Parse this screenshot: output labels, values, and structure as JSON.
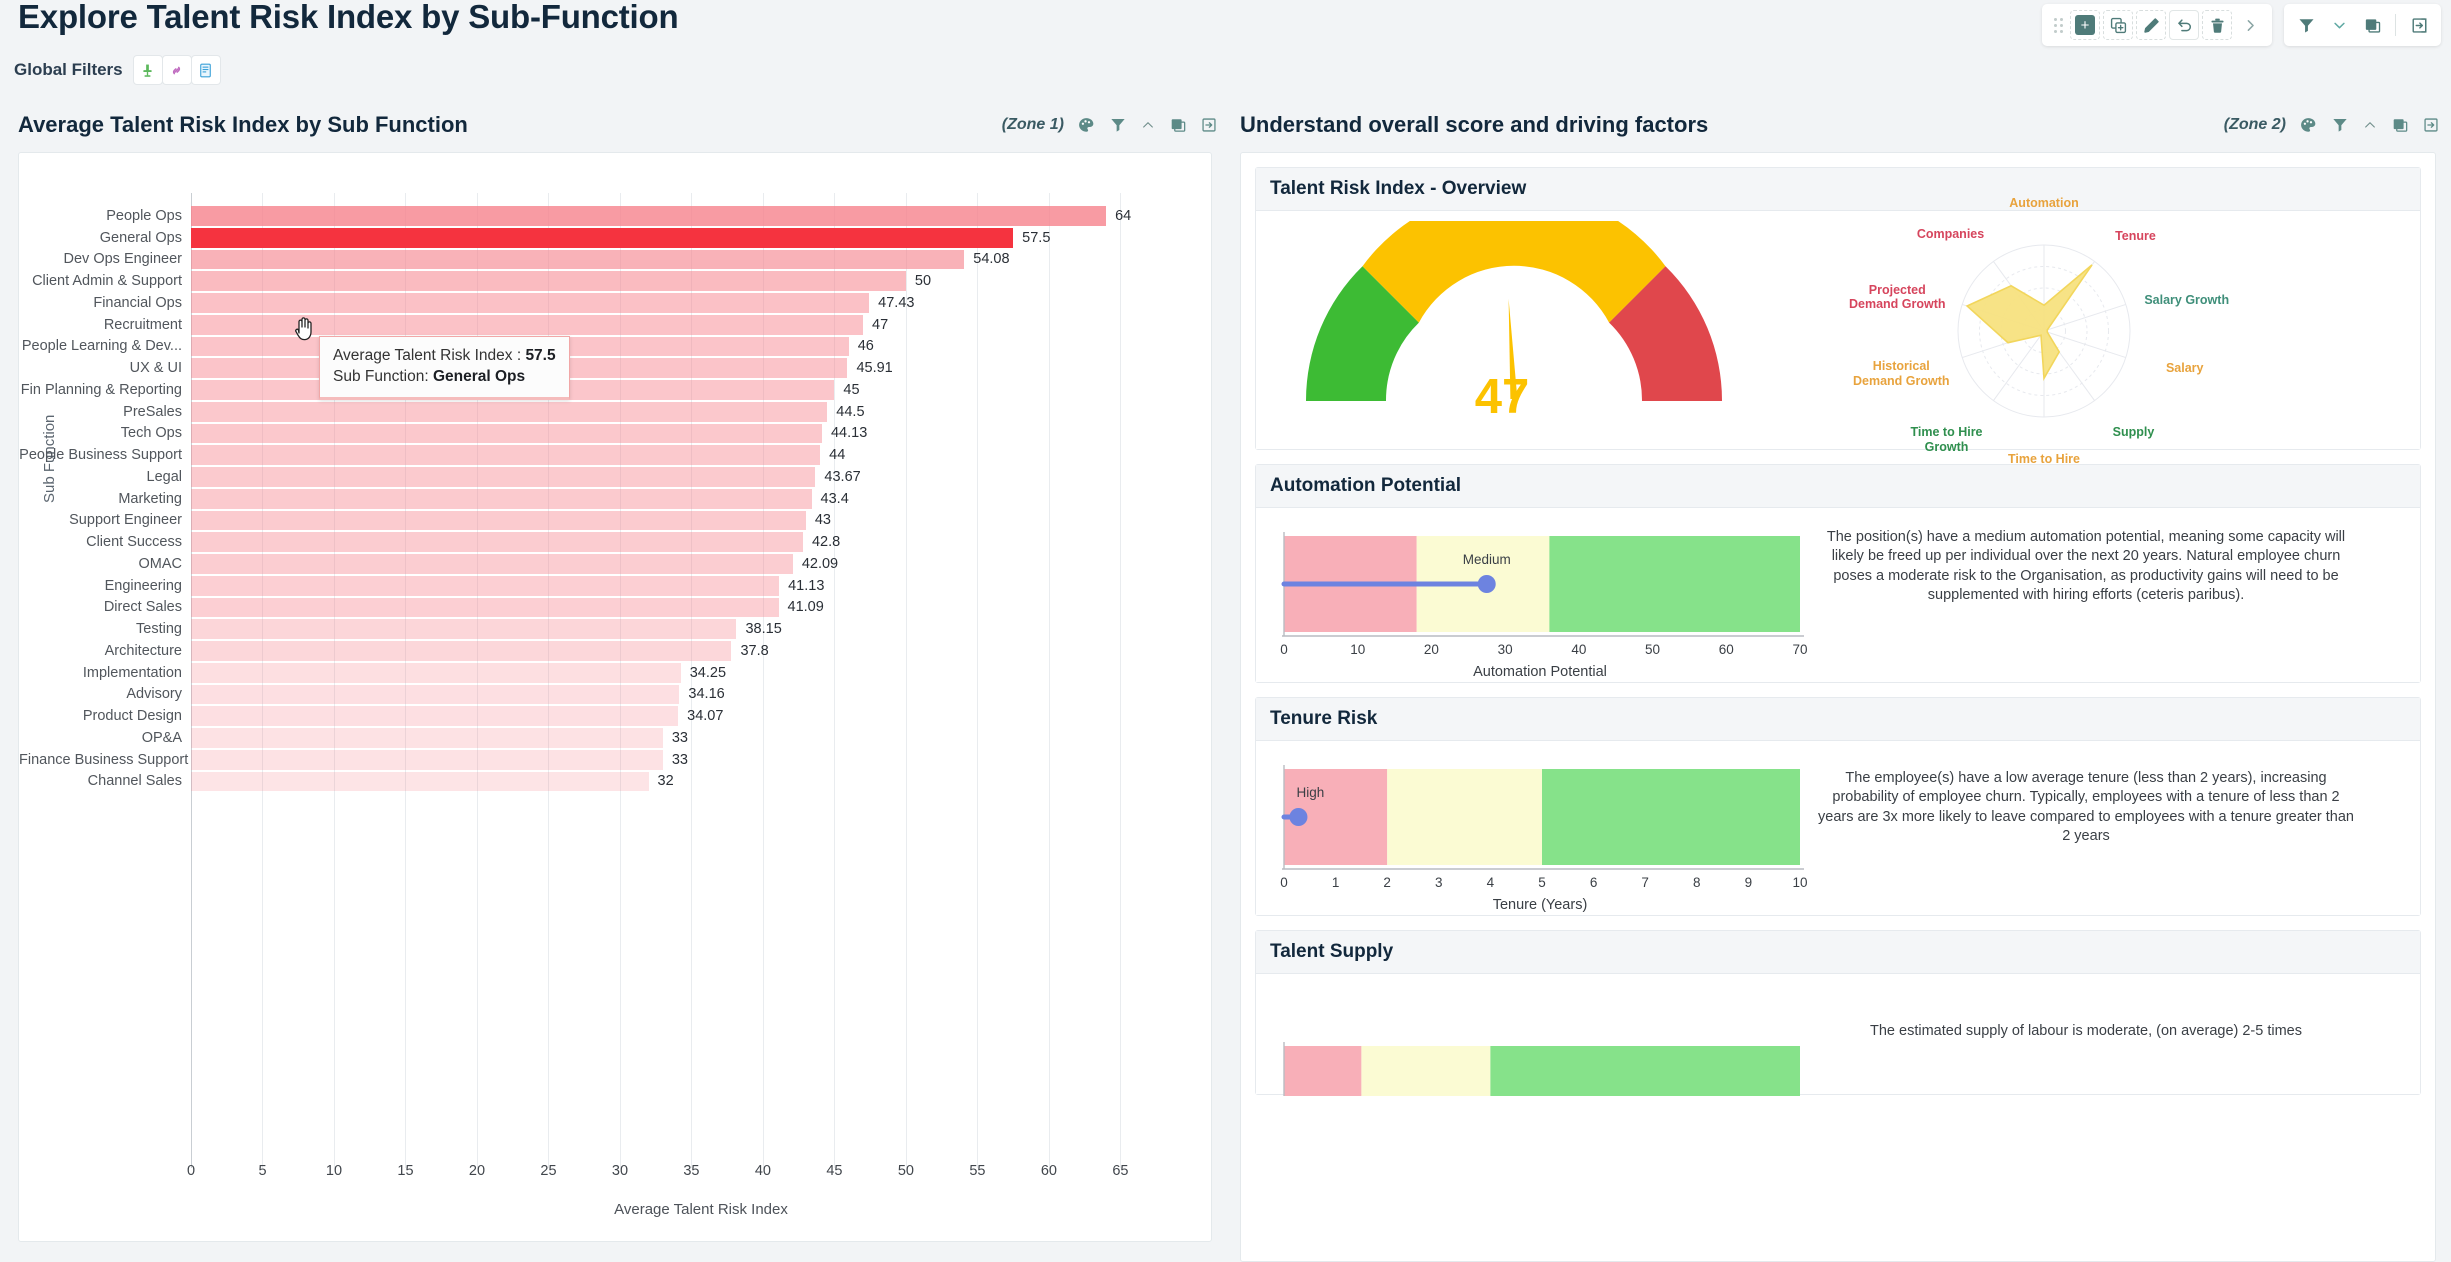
{
  "header": {
    "title": "Explore Talent Risk Index by Sub-Function",
    "global_filters_label": "Global Filters",
    "filter_chips": [
      {
        "icon": "person-filter-icon",
        "glyph": "♟"
      },
      {
        "icon": "link-filter-icon",
        "glyph": "🔗"
      },
      {
        "icon": "document-filter-icon",
        "glyph": "📋"
      }
    ]
  },
  "toolbar": {
    "drag_handle": "drag-handle",
    "buttons": [
      {
        "name": "add-button",
        "label": "+"
      },
      {
        "name": "duplicate-button",
        "label": "⧉"
      },
      {
        "name": "edit-button",
        "label": "✎"
      },
      {
        "name": "undo-button",
        "label": "↺"
      },
      {
        "name": "delete-button",
        "label": "🗑"
      },
      {
        "name": "next-button",
        "label": "›"
      }
    ],
    "right_buttons": [
      {
        "name": "filter-button",
        "label": "filter-icon"
      },
      {
        "name": "chevron-down-button",
        "label": "chevron-down-icon"
      },
      {
        "name": "layers-button",
        "label": "layers-icon"
      },
      {
        "name": "export-button",
        "label": "export-icon"
      }
    ]
  },
  "zone1": {
    "title": "Average Talent Risk Index by Sub Function",
    "tag": "(Zone 1)",
    "icons": [
      "palette-icon",
      "filter-icon",
      "chevron-up-icon",
      "layers-icon",
      "export-icon"
    ]
  },
  "zone2": {
    "title": "Understand overall score and driving factors",
    "tag": "(Zone 2)",
    "icons": [
      "palette-icon",
      "filter-icon",
      "chevron-up-icon",
      "layers-icon",
      "export-icon"
    ]
  },
  "tooltip": {
    "metric_label": "Average Talent Risk Index :",
    "metric_value": "57.5",
    "dim_label": "Sub Function:",
    "dim_value": "General Ops"
  },
  "cards": {
    "overview": "Talent Risk Index - Overview",
    "automation": "Automation Potential",
    "tenure": "Tenure Risk",
    "supply": "Talent Supply"
  },
  "gauge": {
    "value": "47",
    "min": 0,
    "max": 100,
    "bands": [
      {
        "from": 0,
        "to": 30,
        "color": "#3dbb34"
      },
      {
        "from": 30,
        "to": 70,
        "color": "#fcc200"
      },
      {
        "from": 70,
        "to": 100,
        "color": "#e0474c"
      }
    ],
    "needle_color": "#fcc200"
  },
  "automation_bullet": {
    "axis_title": "Automation Potential",
    "ticks": [
      "0",
      "10",
      "20",
      "30",
      "40",
      "50",
      "60",
      "70"
    ],
    "min": 0,
    "max": 70,
    "bands": [
      {
        "from": 0,
        "to": 18,
        "color": "#f8afb8"
      },
      {
        "from": 18,
        "to": 36,
        "color": "#fbfbd3"
      },
      {
        "from": 36,
        "to": 70,
        "color": "#86e28a"
      }
    ],
    "marker_value": 27.5,
    "marker_label": "Medium",
    "marker_color": "#6d83e0",
    "description": "The position(s) have a medium automation potential, meaning some capacity will likely be freed up per individual over the next 20 years. Natural employee churn poses a moderate risk to the Organisation, as productivity gains will need to be supplemented with hiring efforts (ceteris paribus)."
  },
  "tenure_bullet": {
    "axis_title": "Tenure (Years)",
    "ticks": [
      "0",
      "1",
      "2",
      "3",
      "4",
      "5",
      "6",
      "7",
      "8",
      "9",
      "10"
    ],
    "min": 0,
    "max": 10,
    "bands": [
      {
        "from": 0,
        "to": 2,
        "color": "#f8afb8"
      },
      {
        "from": 2,
        "to": 5,
        "color": "#fbfbd3"
      },
      {
        "from": 5,
        "to": 10,
        "color": "#86e28a"
      }
    ],
    "marker_value": 0.28,
    "marker_label": "High",
    "marker_color": "#6d83e0",
    "description": "The employee(s) have a low average tenure (less than 2 years), increasing probability of employee churn. Typically, employees with a tenure of less than 2 years are 3x more likely to leave compared to employees with a tenure greater than 2 years"
  },
  "supply_bullet": {
    "bands": [
      {
        "from": 0,
        "to": 15,
        "color": "#f8afb8"
      },
      {
        "from": 15,
        "to": 40,
        "color": "#fbfbd3"
      },
      {
        "from": 40,
        "to": 100,
        "color": "#86e28a"
      }
    ],
    "description": "The estimated supply of labour is moderate, (on average) 2-5 times"
  },
  "radar": {
    "axes": [
      {
        "label": "Automation",
        "value": 0.3,
        "color": "#e8a33d"
      },
      {
        "label": "Tenure",
        "value": 0.95,
        "color": "#d6455d"
      },
      {
        "label": "Salary Growth",
        "value": 0.04,
        "color": "#3f8f7a"
      },
      {
        "label": "Salary",
        "value": 0.04,
        "color": "#e8a33d"
      },
      {
        "label": "Supply",
        "value": 0.3,
        "color": "#2f8f4e"
      },
      {
        "label": "Time to Hire",
        "value": 0.55,
        "color": "#e8a33d"
      },
      {
        "label": "Time to Hire Growth",
        "value": 0.06,
        "color": "#2f8f4e"
      },
      {
        "label": "Historical Demand Growth",
        "value": 0.44,
        "color": "#e8a33d"
      },
      {
        "label": "Projected Demand Growth",
        "value": 0.94,
        "color": "#d6455d"
      },
      {
        "label": "Companies",
        "value": 0.65,
        "color": "#d6455d"
      }
    ],
    "fill_color": "#f7e27f",
    "stroke_color": "#f2d65c"
  },
  "chart_data": {
    "type": "bar",
    "orientation": "horizontal",
    "title": "Average Talent Risk Index by Sub Function",
    "xlabel": "Average Talent Risk Index",
    "ylabel": "Sub Function",
    "xlim": [
      0,
      67
    ],
    "xticks": [
      0,
      5,
      10,
      15,
      20,
      25,
      30,
      35,
      40,
      45,
      50,
      55,
      60,
      65
    ],
    "grid": true,
    "highlighted_category": "General Ops",
    "highlight_color": "#f5333f",
    "bar_color": "#f9c8cd",
    "categories": [
      "People Ops",
      "General Ops",
      "Dev Ops Engineer",
      "Client Admin & Support",
      "Financial Ops",
      "Recruitment",
      "People Learning & Dev...",
      "UX & UI",
      "Fin Planning & Reporting",
      "PreSales",
      "Tech Ops",
      "People Business Support",
      "Legal",
      "Marketing",
      "Support Engineer",
      "Client Success",
      "OMAC",
      "Engineering",
      "Direct Sales",
      "Testing",
      "Architecture",
      "Implementation",
      "Advisory",
      "Product Design",
      "OP&A",
      "Finance Business Support",
      "Channel Sales"
    ],
    "values": [
      64,
      57.5,
      54.08,
      50,
      47.43,
      47,
      46,
      45.91,
      45,
      44.5,
      44.13,
      44,
      43.67,
      43.4,
      43,
      42.8,
      42.09,
      41.13,
      41.09,
      38.15,
      37.8,
      34.25,
      34.16,
      34.07,
      33,
      33,
      32
    ],
    "value_labels": [
      "64",
      "57.5",
      "54.08",
      "50",
      "47.43",
      "47",
      "46",
      "45.91",
      "45",
      "44.5",
      "44.13",
      "44",
      "43.67",
      "43.4",
      "43",
      "42.8",
      "42.09",
      "41.13",
      "41.09",
      "38.15",
      "37.8",
      "34.25",
      "34.16",
      "34.07",
      "33",
      "33",
      "32"
    ]
  }
}
